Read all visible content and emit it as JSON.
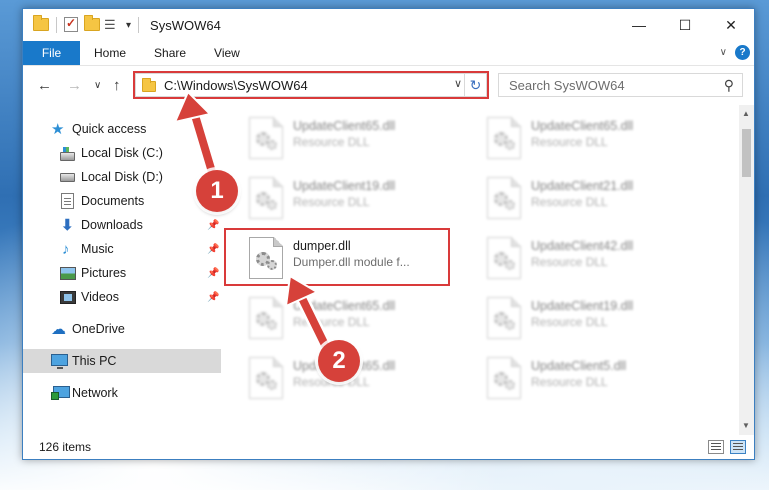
{
  "window": {
    "title": "SysWOW64",
    "controls": {
      "minimize": "—",
      "maximize": "☐",
      "close": "✕"
    }
  },
  "ribbon": {
    "file_tab": "File",
    "tabs": [
      "Home",
      "Share",
      "View"
    ],
    "expand_glyph": "∨",
    "help_glyph": "?"
  },
  "address_bar": {
    "path": "C:\\Windows\\SysWOW64",
    "dropdown_glyph": "∨",
    "refresh_glyph": "↻",
    "back_glyph": "←",
    "forward_glyph": "→",
    "recent_glyph": "∨",
    "up_glyph": "↑"
  },
  "search": {
    "placeholder": "Search SysWOW64",
    "icon": "search-icon"
  },
  "sidebar": {
    "items": [
      {
        "label": "Quick access",
        "icon": "star-icon",
        "pinned": false
      },
      {
        "label": "Local Disk (C:)",
        "icon": "local-disk-icon",
        "pinned": true
      },
      {
        "label": "Local Disk (D:)",
        "icon": "local-disk-icon",
        "pinned": true
      },
      {
        "label": "Documents",
        "icon": "documents-icon",
        "pinned": true
      },
      {
        "label": "Downloads",
        "icon": "downloads-icon",
        "pinned": true
      },
      {
        "label": "Music",
        "icon": "music-icon",
        "pinned": true
      },
      {
        "label": "Pictures",
        "icon": "pictures-icon",
        "pinned": true
      },
      {
        "label": "Videos",
        "icon": "videos-icon",
        "pinned": true
      },
      {
        "label": "OneDrive",
        "icon": "onedrive-icon",
        "pinned": false
      },
      {
        "label": "This PC",
        "icon": "this-pc-icon",
        "pinned": false,
        "selected": true
      },
      {
        "label": "Network",
        "icon": "network-icon",
        "pinned": false
      }
    ],
    "pin_glyph": "📌"
  },
  "files": [
    {
      "name": "UpdateClient65.dll",
      "desc": "Resource DLL",
      "blurred": true
    },
    {
      "name": "UpdateClient65.dll",
      "desc": "Resource DLL",
      "blurred": true
    },
    {
      "name": "UpdateClient19.dll",
      "desc": "Resource DLL",
      "blurred": true
    },
    {
      "name": "UpdateClient21.dll",
      "desc": "Resource DLL",
      "blurred": true
    },
    {
      "name": "dumper.dll",
      "desc": "Dumper.dll module f...",
      "blurred": false
    },
    {
      "name": "UpdateClient42.dll",
      "desc": "Resource DLL",
      "blurred": true
    },
    {
      "name": "UpdateClient65.dll",
      "desc": "Resource DLL",
      "blurred": true
    },
    {
      "name": "UpdateClient19.dll",
      "desc": "Resource DLL",
      "blurred": true
    },
    {
      "name": "UpdateClient65.dll",
      "desc": "Resource DLL",
      "blurred": true
    },
    {
      "name": "UpdateClient5.dll",
      "desc": "Resource DLL",
      "blurred": true
    }
  ],
  "status": {
    "item_count": "126 items"
  },
  "annotations": {
    "step1": "1",
    "step2": "2",
    "highlight_color": "#d93a3a",
    "callout_color": "#d6413a"
  },
  "colors": {
    "accent": "#1979ca",
    "selection": "#d9d9d9"
  }
}
